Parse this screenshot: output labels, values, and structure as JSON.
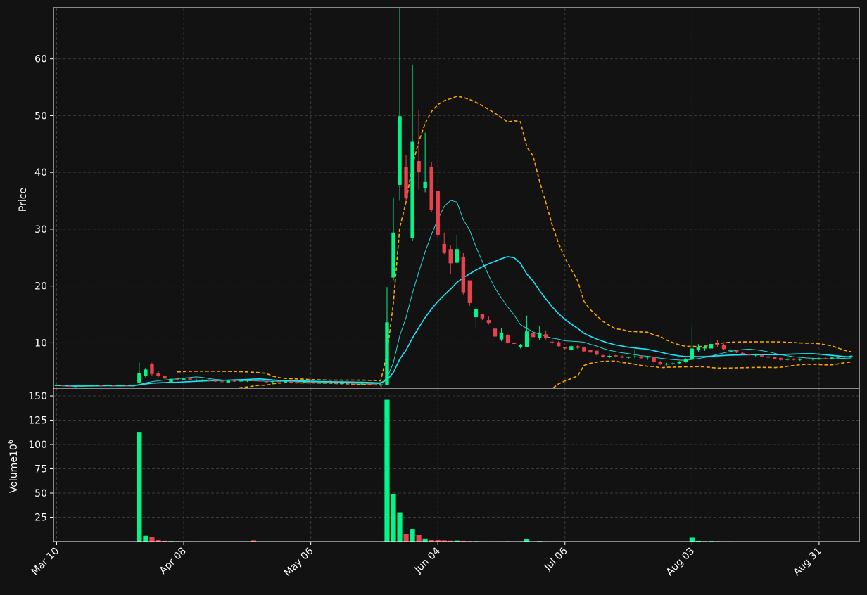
{
  "colors": {
    "background": "#121212",
    "up": "#00f58a",
    "down": "#e8424f",
    "ma_fast": "#2fd3d3",
    "ma_slow": "#19e6ff",
    "bands": "#ffa500",
    "grid": "#3a3a3a",
    "axis": "#ffffff"
  },
  "chart_data": {
    "type": "candlestick",
    "title": "",
    "price_panel": {
      "ylabel": "Price",
      "ylim": [
        2,
        69
      ],
      "yticks": [
        10,
        20,
        30,
        40,
        50,
        60
      ],
      "grid": true
    },
    "volume_panel": {
      "ylabel": "Volume",
      "ylabel_exponent": "6",
      "ylim": [
        0,
        158
      ],
      "yticks": [
        25,
        50,
        75,
        100,
        125,
        150
      ],
      "grid": true
    },
    "x_start_date": "Mar 10",
    "xticks": [
      {
        "label": "Mar 10",
        "index": 0
      },
      {
        "label": "Apr 08",
        "index": 20
      },
      {
        "label": "May 06",
        "index": 40
      },
      {
        "label": "Jun 04",
        "index": 60
      },
      {
        "label": "Jul 06",
        "index": 80
      },
      {
        "label": "Aug 03",
        "index": 100
      },
      {
        "label": "Aug 31",
        "index": 120
      }
    ],
    "candles": [
      [
        2.5,
        2.6,
        2.4,
        2.5,
        0.2
      ],
      [
        2.5,
        2.6,
        2.4,
        2.4,
        0.2
      ],
      [
        2.4,
        2.5,
        2.3,
        2.3,
        0.2
      ],
      [
        2.3,
        2.4,
        2.2,
        2.35,
        0.2
      ],
      [
        2.35,
        2.45,
        2.3,
        2.4,
        0.2
      ],
      [
        2.4,
        2.5,
        2.3,
        2.45,
        0.2
      ],
      [
        2.45,
        2.55,
        2.35,
        2.5,
        0.2
      ],
      [
        2.5,
        2.6,
        2.4,
        2.45,
        0.2
      ],
      [
        2.45,
        2.6,
        2.4,
        2.5,
        0.2
      ],
      [
        2.5,
        2.6,
        2.4,
        2.4,
        0.2
      ],
      [
        2.4,
        2.5,
        2.3,
        2.45,
        0.2
      ],
      [
        2.45,
        2.5,
        2.3,
        2.35,
        0.2
      ],
      [
        2.35,
        2.5,
        2.3,
        2.45,
        0.2
      ],
      [
        3.0,
        6.5,
        2.8,
        4.6,
        113
      ],
      [
        4.2,
        5.6,
        3.9,
        5.3,
        6
      ],
      [
        6.2,
        6.5,
        4.2,
        4.5,
        5
      ],
      [
        4.7,
        5.0,
        3.9,
        4.1,
        1.5
      ],
      [
        4.1,
        4.3,
        3.6,
        3.7,
        0.8
      ],
      [
        3.1,
        3.7,
        3.0,
        3.6,
        0.6
      ],
      [
        3.6,
        3.9,
        3.3,
        3.5,
        0.5
      ],
      [
        3.5,
        3.8,
        3.4,
        3.7,
        0.4
      ],
      [
        3.7,
        3.9,
        3.4,
        3.5,
        0.4
      ],
      [
        3.5,
        3.7,
        3.3,
        3.4,
        0.3
      ],
      [
        3.2,
        3.6,
        3.1,
        3.5,
        0.3
      ],
      [
        3.5,
        3.6,
        3.2,
        3.3,
        0.3
      ],
      [
        3.3,
        3.5,
        3.1,
        3.2,
        0.3
      ],
      [
        3.2,
        3.4,
        3.0,
        3.1,
        0.3
      ],
      [
        3.0,
        3.4,
        2.9,
        3.3,
        0.3
      ],
      [
        3.3,
        3.5,
        3.1,
        3.2,
        0.3
      ],
      [
        3.2,
        3.4,
        3.0,
        3.3,
        0.3
      ],
      [
        3.3,
        3.5,
        3.1,
        3.4,
        0.3
      ],
      [
        3.4,
        3.6,
        3.2,
        3.3,
        1.2
      ],
      [
        3.3,
        3.5,
        3.1,
        3.2,
        0.3
      ],
      [
        3.2,
        3.3,
        3.0,
        3.1,
        0.2
      ],
      [
        3.1,
        3.3,
        3.0,
        3.2,
        0.2
      ],
      [
        3.2,
        3.3,
        3.0,
        3.1,
        0.2
      ],
      [
        3.1,
        3.3,
        3.0,
        3.2,
        0.2
      ],
      [
        3.2,
        3.3,
        3.0,
        3.1,
        0.2
      ],
      [
        3.1,
        3.2,
        2.9,
        3.0,
        0.2
      ],
      [
        3.0,
        3.2,
        2.9,
        3.1,
        0.2
      ],
      [
        3.1,
        3.2,
        2.9,
        3.0,
        0.2
      ],
      [
        3.0,
        3.1,
        2.8,
        2.9,
        0.2
      ],
      [
        2.9,
        3.1,
        2.8,
        3.0,
        0.2
      ],
      [
        3.0,
        3.1,
        2.8,
        2.9,
        0.2
      ],
      [
        2.9,
        3.0,
        2.7,
        2.8,
        0.2
      ],
      [
        2.8,
        3.0,
        2.7,
        2.9,
        0.2
      ],
      [
        2.9,
        3.0,
        2.7,
        2.8,
        0.2
      ],
      [
        2.8,
        2.9,
        2.6,
        2.7,
        0.2
      ],
      [
        2.7,
        2.9,
        2.6,
        2.8,
        0.2
      ],
      [
        2.8,
        2.9,
        2.6,
        2.7,
        0.2
      ],
      [
        2.7,
        2.8,
        2.5,
        2.6,
        0.2
      ],
      [
        2.6,
        2.8,
        2.5,
        2.7,
        0.2
      ],
      [
        2.6,
        19.8,
        2.5,
        13.6,
        146
      ],
      [
        21.5,
        35.6,
        21.0,
        29.4,
        49
      ],
      [
        37.8,
        68.9,
        35.0,
        49.9,
        30
      ],
      [
        41.0,
        43.0,
        35.0,
        35.5,
        8
      ],
      [
        28.4,
        59.0,
        28.0,
        45.4,
        13
      ],
      [
        42.0,
        51.0,
        37.0,
        40.0,
        7
      ],
      [
        37.2,
        47.0,
        36.5,
        38.3,
        3
      ],
      [
        41.0,
        41.8,
        33.0,
        33.4,
        1.5
      ],
      [
        36.7,
        36.7,
        28.5,
        29.0,
        1.5
      ],
      [
        27.4,
        29.4,
        25.6,
        25.8,
        1.2
      ],
      [
        26.5,
        27.2,
        22.1,
        24.0,
        0.9
      ],
      [
        24.1,
        29.0,
        24.0,
        26.5,
        1
      ],
      [
        25.1,
        25.8,
        18.5,
        18.9,
        0.8
      ],
      [
        21.0,
        21.0,
        16.5,
        17.0,
        0.6
      ],
      [
        14.5,
        16.2,
        12.6,
        16.0,
        0.5
      ],
      [
        15.0,
        15.0,
        14.0,
        14.3,
        0.4
      ],
      [
        14.0,
        14.6,
        13.2,
        13.5,
        0.4
      ],
      [
        12.5,
        12.5,
        10.8,
        11.1,
        0.4
      ],
      [
        10.6,
        12.6,
        10.3,
        11.8,
        0.4
      ],
      [
        11.4,
        11.5,
        9.9,
        10.0,
        0.5
      ],
      [
        10.0,
        10.2,
        9.5,
        9.8,
        0.3
      ],
      [
        9.3,
        9.8,
        9.0,
        9.6,
        0.4
      ],
      [
        9.3,
        14.8,
        9.2,
        12.0,
        2.5
      ],
      [
        11.7,
        11.7,
        10.8,
        11.0,
        0.4
      ],
      [
        10.8,
        13.0,
        10.5,
        11.8,
        0.6
      ],
      [
        11.5,
        12.2,
        10.6,
        10.8,
        0.4
      ],
      [
        10.2,
        10.4,
        9.8,
        10.1,
        0.3
      ],
      [
        10.1,
        10.3,
        9.2,
        9.4,
        0.3
      ],
      [
        9.2,
        9.3,
        8.8,
        9.0,
        0.3
      ],
      [
        8.8,
        9.6,
        8.7,
        9.4,
        0.3
      ],
      [
        9.4,
        9.6,
        8.9,
        9.1,
        0.3
      ],
      [
        9.2,
        9.2,
        8.4,
        8.5,
        0.3
      ],
      [
        8.8,
        8.8,
        8.2,
        8.3,
        0.3
      ],
      [
        8.6,
        8.6,
        7.8,
        7.9,
        0.3
      ],
      [
        7.8,
        7.9,
        7.4,
        7.5,
        0.3
      ],
      [
        7.5,
        7.9,
        7.3,
        7.7,
        0.3
      ],
      [
        7.8,
        7.9,
        7.5,
        7.6,
        0.3
      ],
      [
        7.6,
        7.8,
        7.3,
        7.4,
        0.3
      ],
      [
        7.4,
        7.6,
        7.2,
        7.5,
        0.3
      ],
      [
        7.5,
        8.8,
        7.3,
        7.6,
        0.3
      ],
      [
        7.6,
        7.8,
        7.2,
        7.3,
        0.3
      ],
      [
        7.4,
        7.7,
        7.0,
        7.6,
        0.3
      ],
      [
        7.5,
        7.6,
        6.5,
        6.6,
        0.3
      ],
      [
        6.6,
        6.8,
        6.1,
        6.2,
        0.3
      ],
      [
        6.2,
        6.5,
        6.0,
        6.3,
        0.3
      ],
      [
        6.3,
        6.6,
        6.1,
        6.4,
        0.3
      ],
      [
        6.4,
        6.8,
        6.2,
        6.7,
        0.3
      ],
      [
        6.7,
        7.3,
        6.5,
        7.1,
        0.3
      ],
      [
        7.2,
        12.8,
        7.0,
        9.0,
        4
      ],
      [
        8.7,
        9.8,
        8.4,
        9.2,
        0.8
      ],
      [
        9.0,
        9.6,
        8.6,
        9.3,
        0.5
      ],
      [
        9.0,
        11.0,
        8.8,
        9.8,
        0.6
      ],
      [
        9.8,
        10.5,
        9.3,
        9.6,
        0.5
      ],
      [
        9.6,
        9.8,
        8.8,
        8.9,
        0.4
      ],
      [
        8.6,
        9.0,
        8.5,
        8.8,
        0.4
      ],
      [
        8.6,
        8.7,
        8.2,
        8.3,
        0.3
      ],
      [
        8.2,
        8.4,
        7.9,
        8.1,
        0.3
      ],
      [
        8.0,
        8.1,
        7.7,
        7.8,
        0.3
      ],
      [
        7.8,
        8.1,
        7.6,
        7.9,
        0.3
      ],
      [
        7.8,
        7.9,
        7.5,
        7.6,
        0.3
      ],
      [
        7.6,
        7.8,
        7.3,
        7.4,
        0.3
      ],
      [
        7.5,
        7.6,
        7.1,
        7.2,
        0.3
      ],
      [
        7.3,
        7.4,
        6.9,
        7.0,
        0.3
      ],
      [
        7.0,
        7.3,
        6.8,
        7.2,
        0.3
      ],
      [
        7.2,
        7.3,
        6.9,
        7.0,
        0.3
      ],
      [
        7.0,
        7.3,
        6.8,
        7.2,
        0.3
      ],
      [
        7.2,
        7.4,
        7.0,
        7.1,
        0.3
      ],
      [
        7.1,
        7.3,
        6.9,
        7.2,
        0.3
      ],
      [
        7.2,
        7.4,
        7.0,
        7.3,
        0.3
      ],
      [
        7.3,
        7.5,
        7.1,
        7.2,
        0.3
      ],
      [
        7.2,
        7.5,
        7.1,
        7.4,
        0.3
      ],
      [
        7.4,
        7.6,
        7.2,
        7.5,
        0.3
      ],
      [
        7.5,
        7.7,
        7.3,
        7.6,
        0.3
      ],
      [
        7.6,
        7.8,
        7.4,
        7.7,
        0.3
      ]
    ]
  }
}
